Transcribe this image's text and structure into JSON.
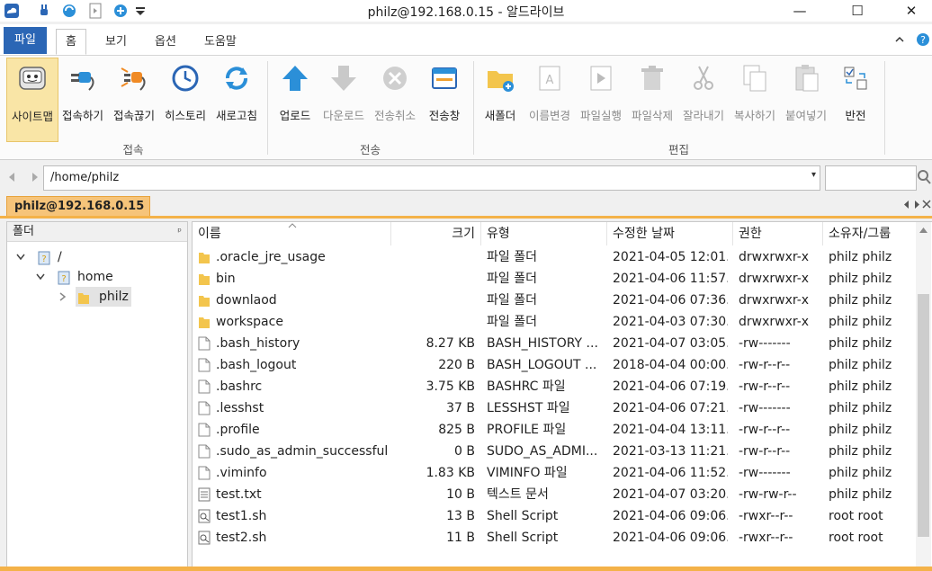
{
  "window": {
    "title": "philz@192.168.0.15 - 알드라이브",
    "minimize_glyph": "—",
    "maximize_glyph": "☐",
    "close_glyph": "✕"
  },
  "quick_access": [
    "cloud-app-icon",
    "plug-icon",
    "refresh-icon",
    "document-icon",
    "add-icon",
    "dropdown-icon"
  ],
  "ribbon_tabs": {
    "file": "파일",
    "home": "홈",
    "view": "보기",
    "options": "옵션",
    "help": "도움말"
  },
  "ribbon": {
    "groups": {
      "connect": "접속",
      "transfer": "전송",
      "edit": "편집"
    },
    "buttons": {
      "site_map": "사이트맵",
      "connect": "접속하기",
      "disconnect": "접속끊기",
      "history": "히스토리",
      "refresh": "새로고침",
      "upload": "업로드",
      "download": "다운로드",
      "cancel_transfer": "전송취소",
      "transfer_window": "전송창",
      "new_folder": "새폴더",
      "rename": "이름변경",
      "run_file": "파일실행",
      "delete_file": "파일삭제",
      "cut": "잘라내기",
      "copy": "복사하기",
      "paste": "붙여넣기",
      "invert": "반전"
    }
  },
  "address": {
    "path": "/home/philz",
    "dropdown_glyph": "▾"
  },
  "session_tab": {
    "label": "philz@192.168.0.15"
  },
  "folder_panel": {
    "header": "폴더",
    "pin_glyph": "ᵖ",
    "tree": [
      {
        "label": "/",
        "expanded": true
      },
      {
        "label": "home",
        "expanded": true
      },
      {
        "label": "philz",
        "expanded": false,
        "selected": true
      }
    ]
  },
  "file_list": {
    "columns": {
      "name": "이름",
      "size": "크기",
      "type": "유형",
      "modified": "수정한 날짜",
      "perm": "권한",
      "owner": "소유자/그룹"
    },
    "rows": [
      {
        "icon": "folder",
        "name": ".oracle_jre_usage",
        "size": "",
        "type": "파일 폴더",
        "modified": "2021-04-05 12:01...",
        "perm": "drwxrwxr-x",
        "owner": "philz philz"
      },
      {
        "icon": "folder",
        "name": "bin",
        "size": "",
        "type": "파일 폴더",
        "modified": "2021-04-06 11:57...",
        "perm": "drwxrwxr-x",
        "owner": "philz philz"
      },
      {
        "icon": "folder",
        "name": "downlaod",
        "size": "",
        "type": "파일 폴더",
        "modified": "2021-04-06 07:36...",
        "perm": "drwxrwxr-x",
        "owner": "philz philz"
      },
      {
        "icon": "folder",
        "name": "workspace",
        "size": "",
        "type": "파일 폴더",
        "modified": "2021-04-03 07:30...",
        "perm": "drwxrwxr-x",
        "owner": "philz philz"
      },
      {
        "icon": "file",
        "name": ".bash_history",
        "size": "8.27 KB",
        "type": "BASH_HISTORY ...",
        "modified": "2021-04-07 03:05...",
        "perm": "-rw-------",
        "owner": "philz philz"
      },
      {
        "icon": "file",
        "name": ".bash_logout",
        "size": "220 B",
        "type": "BASH_LOGOUT ...",
        "modified": "2018-04-04 00:00...",
        "perm": "-rw-r--r--",
        "owner": "philz philz"
      },
      {
        "icon": "file",
        "name": ".bashrc",
        "size": "3.75 KB",
        "type": "BASHRC 파일",
        "modified": "2021-04-06 07:19...",
        "perm": "-rw-r--r--",
        "owner": "philz philz"
      },
      {
        "icon": "file",
        "name": ".lesshst",
        "size": "37 B",
        "type": "LESSHST 파일",
        "modified": "2021-04-06 07:21...",
        "perm": "-rw-------",
        "owner": "philz philz"
      },
      {
        "icon": "file",
        "name": ".profile",
        "size": "825 B",
        "type": "PROFILE 파일",
        "modified": "2021-04-04 13:11...",
        "perm": "-rw-r--r--",
        "owner": "philz philz"
      },
      {
        "icon": "file",
        "name": ".sudo_as_admin_successful",
        "size": "0 B",
        "type": "SUDO_AS_ADMI...",
        "modified": "2021-03-13 11:21...",
        "perm": "-rw-r--r--",
        "owner": "philz philz"
      },
      {
        "icon": "file",
        "name": ".viminfo",
        "size": "1.83 KB",
        "type": "VIMINFO 파일",
        "modified": "2021-04-06 11:52...",
        "perm": "-rw-------",
        "owner": "philz philz"
      },
      {
        "icon": "text",
        "name": "test.txt",
        "size": "10 B",
        "type": "텍스트 문서",
        "modified": "2021-04-07 03:20...",
        "perm": "-rw-rw-r--",
        "owner": "philz philz"
      },
      {
        "icon": "script",
        "name": "test1.sh",
        "size": "13 B",
        "type": "Shell Script",
        "modified": "2021-04-06 09:06...",
        "perm": "-rwxr--r--",
        "owner": "root root"
      },
      {
        "icon": "script",
        "name": "test2.sh",
        "size": "11 B",
        "type": "Shell Script",
        "modified": "2021-04-06 09:06...",
        "perm": "-rwxr--r--",
        "owner": "root root"
      }
    ]
  },
  "colors": {
    "accent": "#2b66b5",
    "session_tab": "#f6c47a",
    "session_border": "#f4b249",
    "folder": "#f3c54d",
    "selected_button": "#f9e5a6"
  }
}
